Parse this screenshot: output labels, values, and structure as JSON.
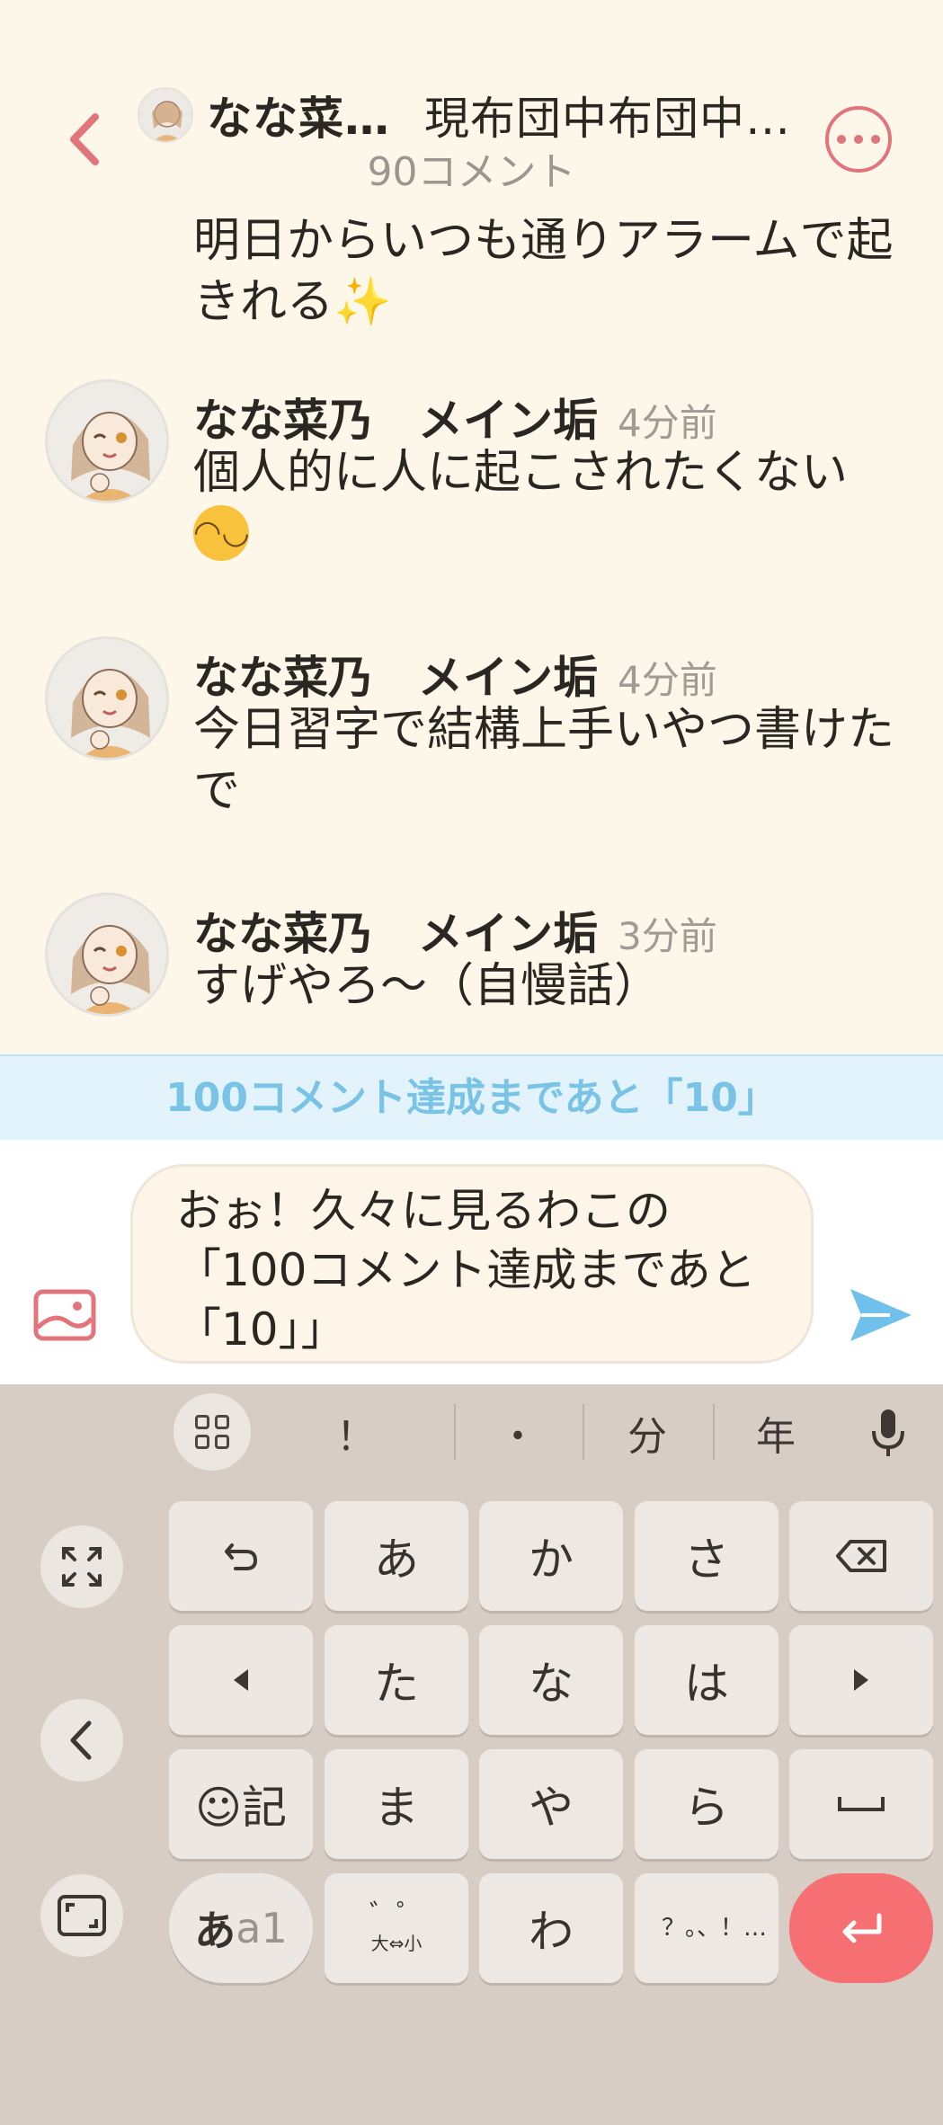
{
  "header": {
    "author": "なな菜…",
    "topic": "現布団中布団中…",
    "comment_count": "90コメント"
  },
  "comments": [
    {
      "author": "",
      "time": "",
      "body": "明日からいつも通りアラームで起きれる"
    },
    {
      "author": "なな菜乃　メイン垢",
      "time": "4分前",
      "body": "個人的に人に起こされたくない"
    },
    {
      "author": "なな菜乃　メイン垢",
      "time": "4分前",
      "body": "今日習字で結構上手いやつ書けたで"
    },
    {
      "author": "なな菜乃　メイン垢",
      "time": "3分前",
      "body": "すげやろ〜（自慢話）"
    }
  ],
  "banner": "100コメント達成まであと「10」",
  "input": {
    "value": "おぉ！久々に見るわこの「100コメント達成まであと「10」」"
  },
  "keyboard": {
    "suggestions": [
      "！",
      "・",
      "分",
      "年"
    ],
    "rows": [
      [
        "あ",
        "か",
        "さ"
      ],
      [
        "た",
        "な",
        "は"
      ],
      [
        "ま",
        "や",
        "ら"
      ],
      [
        "わ"
      ]
    ],
    "emoji_key": "☺記",
    "lang_key_kana": "あ",
    "lang_key_alpha": "a1",
    "dakuten_key": "゛゜",
    "dakuten_sub": "大⇔小",
    "punct_key": "？。、！…"
  },
  "colors": {
    "background": "#fdf7ea",
    "accent": "#e2747c",
    "banner_bg": "#e2f3fb",
    "banner_text": "#79c3e6",
    "send": "#6fc0ea",
    "enter": "#f56f73",
    "keyboard_bg": "#d8cdc5"
  }
}
